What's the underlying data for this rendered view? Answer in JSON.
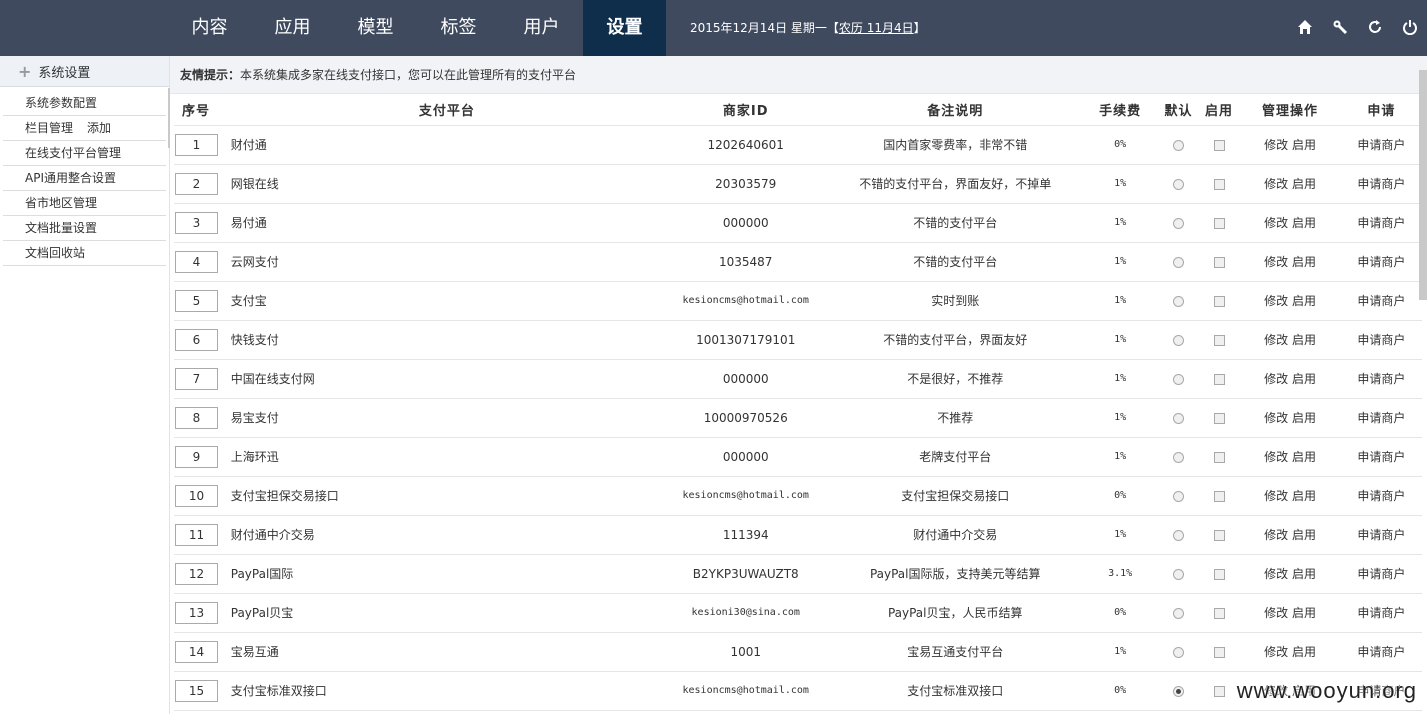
{
  "nav": {
    "items": [
      "内容",
      "应用",
      "模型",
      "标签",
      "用户",
      "设置"
    ],
    "active": 5,
    "date": "2015年12月14日 星期一【",
    "lunar": "农历 11月4日",
    "date_end": "】",
    "icons": [
      "home-icon",
      "wrench-icon",
      "refresh-icon",
      "power-icon"
    ]
  },
  "sidebar": {
    "title": "系统设置",
    "items": [
      {
        "label": "系统参数配置"
      },
      {
        "label": "栏目管理",
        "extra": "添加"
      },
      {
        "label": "在线支付平台管理"
      },
      {
        "label": "API通用整合设置"
      },
      {
        "label": "省市地区管理"
      },
      {
        "label": "文档批量设置"
      },
      {
        "label": "文档回收站"
      }
    ]
  },
  "tip": {
    "label": "友情提示：",
    "text": "本系统集成多家在线支付接口，您可以在此管理所有的支付平台"
  },
  "table": {
    "headers": [
      "序号",
      "支付平台",
      "商家ID",
      "备注说明",
      "手续费",
      "默认",
      "启用",
      "管理操作",
      "申请"
    ],
    "edit_label": "修改",
    "enable_label": "启用",
    "apply_label": "申请商户",
    "rows": [
      {
        "no": "1",
        "name": "财付通",
        "mid": "1202640601",
        "memo": "国内首家零费率，非常不错",
        "fee": "0%",
        "default": false,
        "mono": false
      },
      {
        "no": "2",
        "name": "网银在线",
        "mid": "20303579",
        "memo": "不错的支付平台，界面友好，不掉单",
        "fee": "1%",
        "default": false,
        "mono": false
      },
      {
        "no": "3",
        "name": "易付通",
        "mid": "000000",
        "memo": "不错的支付平台",
        "fee": "1%",
        "default": false,
        "mono": false
      },
      {
        "no": "4",
        "name": "云网支付",
        "mid": "1035487",
        "memo": "不错的支付平台",
        "fee": "1%",
        "default": false,
        "mono": false
      },
      {
        "no": "5",
        "name": "支付宝",
        "mid": "kesioncms@hotmail.com",
        "memo": "实时到账",
        "fee": "1%",
        "default": false,
        "mono": true
      },
      {
        "no": "6",
        "name": "快钱支付",
        "mid": "1001307179101",
        "memo": "不错的支付平台，界面友好",
        "fee": "1%",
        "default": false,
        "mono": false
      },
      {
        "no": "7",
        "name": "中国在线支付网",
        "mid": "000000",
        "memo": "不是很好，不推荐",
        "fee": "1%",
        "default": false,
        "mono": false
      },
      {
        "no": "8",
        "name": "易宝支付",
        "mid": "10000970526",
        "memo": "不推荐",
        "fee": "1%",
        "default": false,
        "mono": false
      },
      {
        "no": "9",
        "name": "上海环迅",
        "mid": "000000",
        "memo": "老牌支付平台",
        "fee": "1%",
        "default": false,
        "mono": false
      },
      {
        "no": "10",
        "name": "支付宝担保交易接口",
        "mid": "kesioncms@hotmail.com",
        "memo": "支付宝担保交易接口",
        "fee": "0%",
        "default": false,
        "mono": true
      },
      {
        "no": "11",
        "name": "财付通中介交易",
        "mid": "111394",
        "memo": "财付通中介交易",
        "fee": "1%",
        "default": false,
        "mono": false
      },
      {
        "no": "12",
        "name": "PayPal国际",
        "mid": "B2YKP3UWAUZT8",
        "memo": "PayPal国际版，支持美元等结算",
        "fee": "3.1%",
        "default": false,
        "mono": false
      },
      {
        "no": "13",
        "name": "PayPal贝宝",
        "mid": "kesioni30@sina.com",
        "memo": "PayPal贝宝，人民币结算",
        "fee": "0%",
        "default": false,
        "mono": true
      },
      {
        "no": "14",
        "name": "宝易互通",
        "mid": "1001",
        "memo": "宝易互通支付平台",
        "fee": "1%",
        "default": false,
        "mono": false
      },
      {
        "no": "15",
        "name": "支付宝标准双接口",
        "mid": "kesioncms@hotmail.com",
        "memo": "支付宝标准双接口",
        "fee": "0%",
        "default": true,
        "mono": true
      }
    ]
  },
  "watermark": "www.wooyun.org"
}
